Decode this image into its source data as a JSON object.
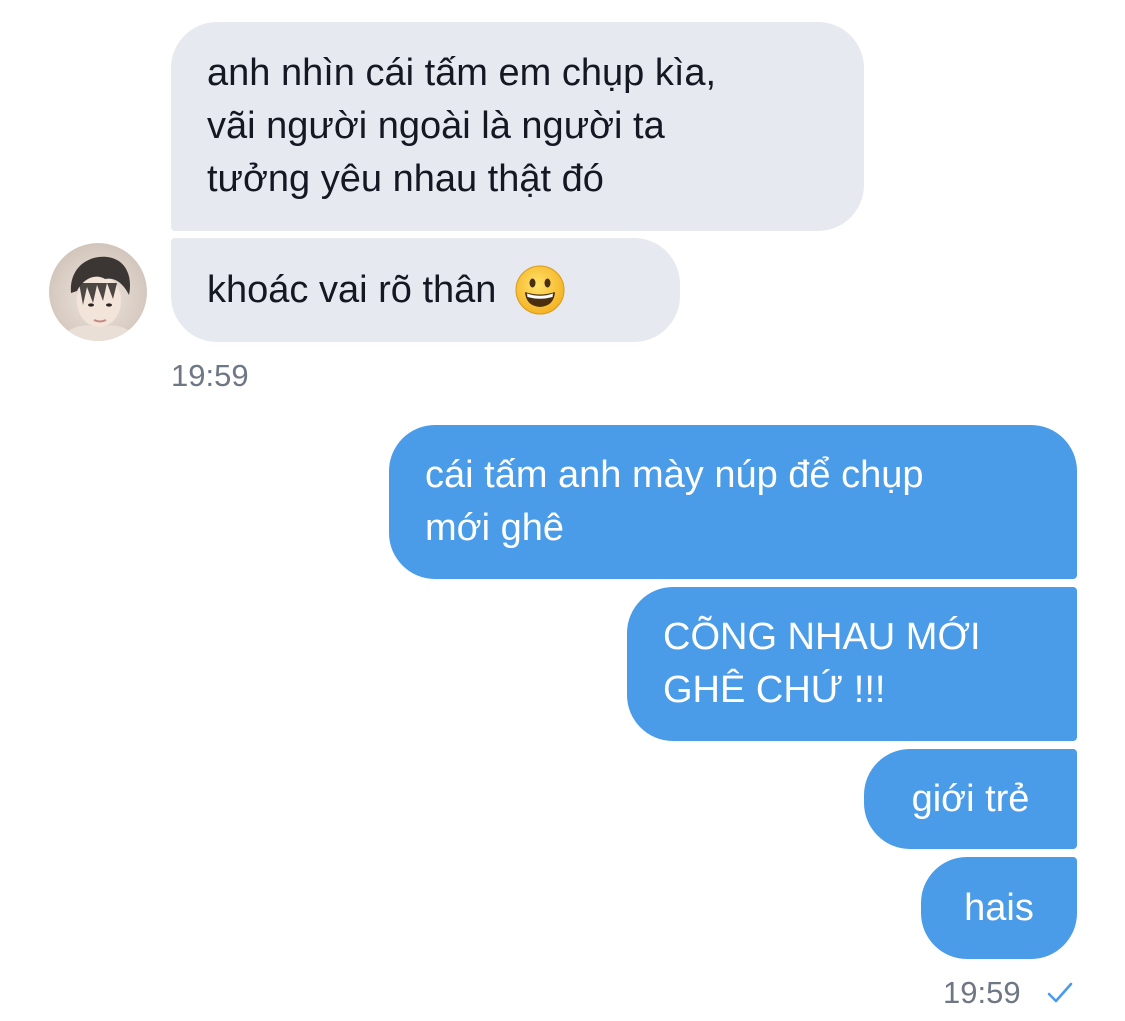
{
  "conversation": {
    "incoming": {
      "messages": [
        {
          "text": "anh nhìn cái tấm em chụp kìa,\nvãi người ngoài là người ta\ntưởng yêu nhau thật đó"
        },
        {
          "text": "khoác vai rõ thân",
          "emoji": "grinning-face-emoji"
        }
      ],
      "time": "19:59",
      "avatar_icon": "user-avatar-photo"
    },
    "outgoing": {
      "messages": [
        {
          "text": "cái tấm anh mày núp để chụp\nmới ghê"
        },
        {
          "text": "CÕNG NHAU MỚI\nGHÊ CHỨ !!!"
        },
        {
          "text": "giới trẻ"
        },
        {
          "text": "hais"
        }
      ],
      "time": "19:59",
      "status_icon": "checkmark-icon"
    },
    "colors": {
      "incoming_bubble": "#e6e9ef",
      "outgoing_bubble": "#4a9be8",
      "timestamp": "#6e7783"
    }
  }
}
